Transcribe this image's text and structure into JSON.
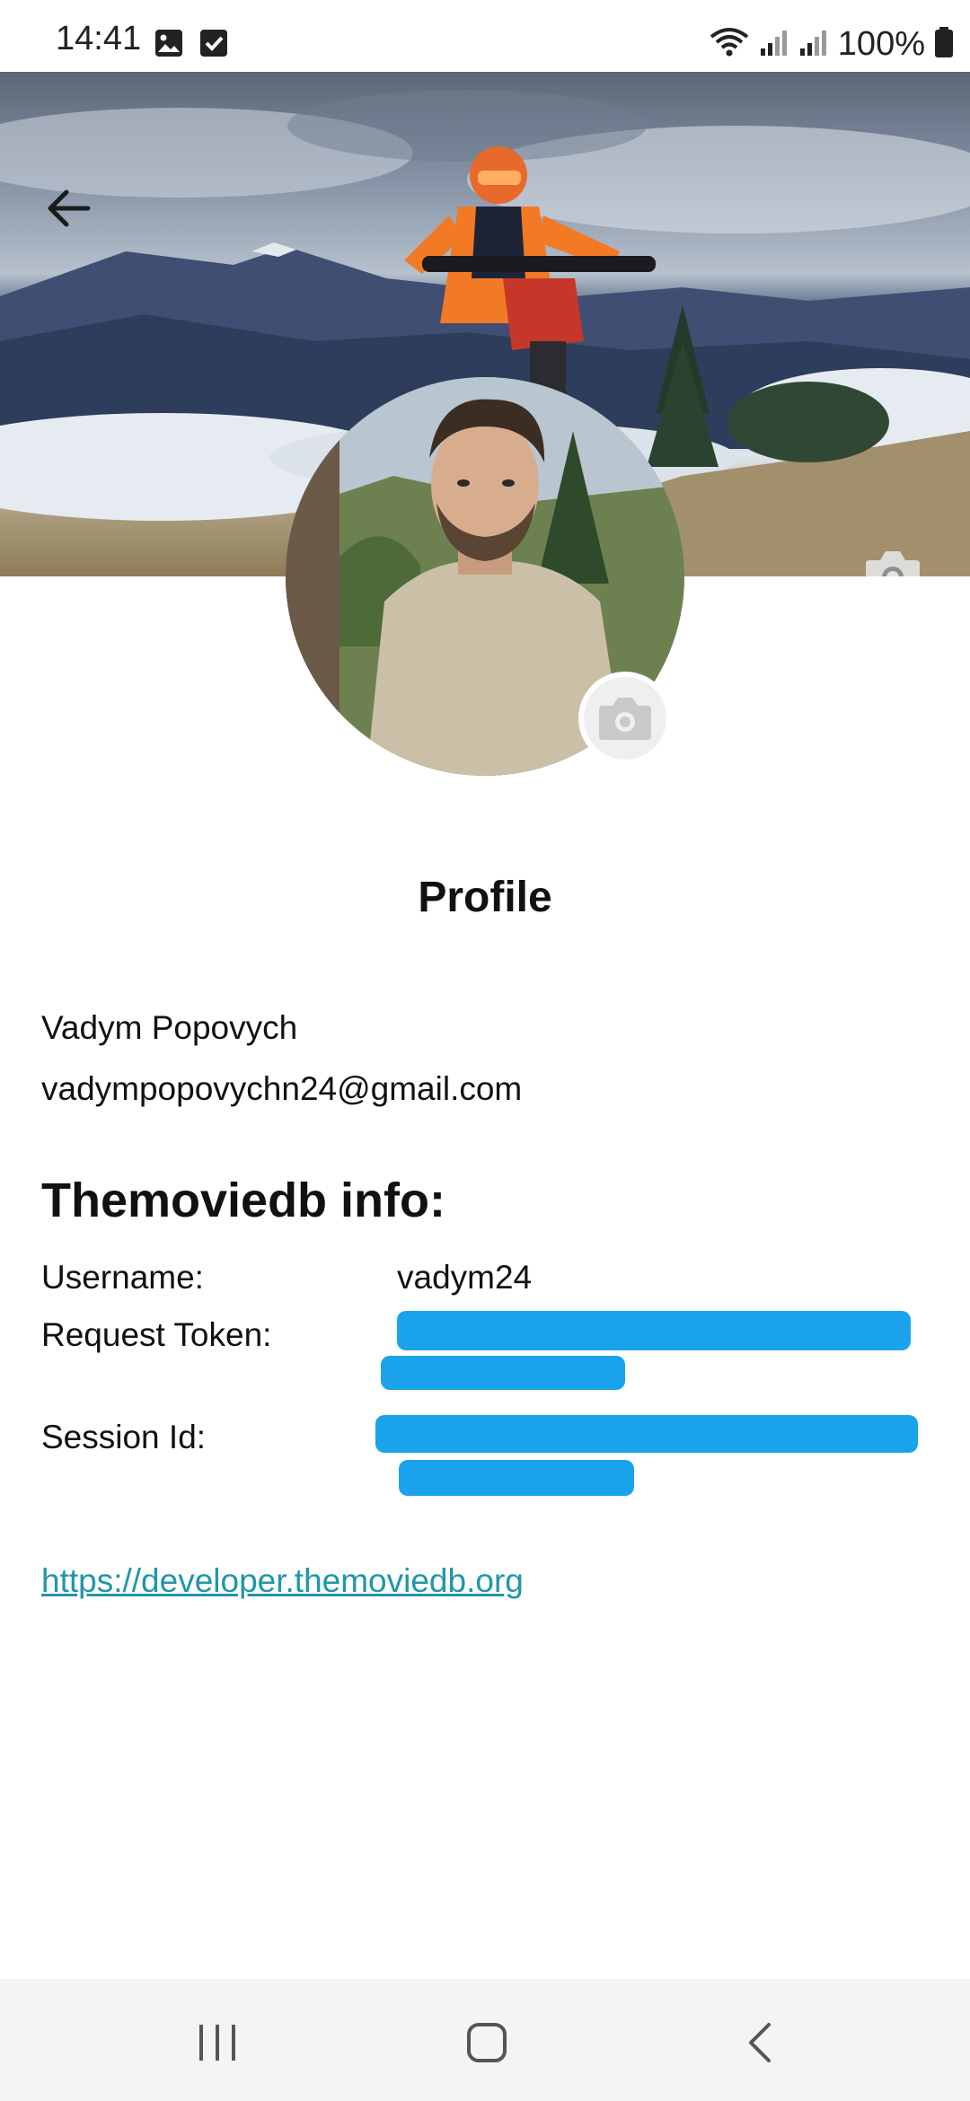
{
  "status_bar": {
    "time": "14:41",
    "battery": "100%",
    "icons_left": [
      "gallery-icon",
      "checkbox-icon"
    ],
    "icons_right": [
      "wifi-icon",
      "signal-icon",
      "signal-icon",
      "battery-icon"
    ]
  },
  "header": {
    "back_icon": "arrow-left-icon",
    "cover_camera_icon": "camera-icon",
    "avatar_camera_icon": "camera-icon"
  },
  "profile": {
    "title": "Profile",
    "name": "Vadym Popovych",
    "email": "vadympopovychn24@gmail.com"
  },
  "tmdb": {
    "section_title": "Themoviedb info:",
    "username_label": "Username:",
    "username_value": "vadym24",
    "request_token_label": "Request Token:",
    "session_id_label": "Session Id:",
    "link": "https://developer.themoviedb.org"
  },
  "nav_bar": {
    "recents_icon": "recents-icon",
    "home_icon": "home-icon",
    "back_icon": "back-icon"
  },
  "colors": {
    "link": "#2196a8",
    "redaction": "#1aa3ea",
    "nav_background": "#f4f4f6"
  }
}
